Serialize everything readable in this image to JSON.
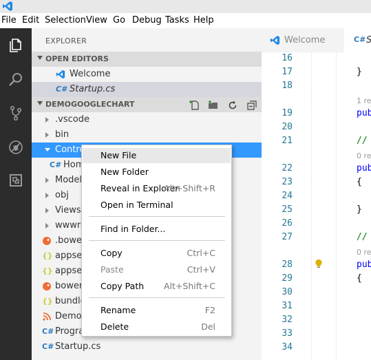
{
  "menubar": [
    "File",
    "Edit",
    "Selection",
    "View",
    "Go",
    "Debug",
    "Tasks",
    "Help"
  ],
  "activity": [
    "explorer-icon",
    "search-icon",
    "source-control-icon",
    "debug-icon",
    "extensions-icon"
  ],
  "explorer": {
    "title": "EXPLORER",
    "open_editors_label": "OPEN EDITORS",
    "open_editors": [
      "Welcome",
      "Startup.cs"
    ],
    "project_label": "DEMOGOOGLECHART",
    "tree": [
      ".vscode",
      "bin",
      "Contro",
      "Hom",
      "Model",
      "obj",
      "Views",
      "wwwro",
      ".bower",
      "appset",
      "appset",
      "bower.",
      "bundle",
      "DemoG",
      "Progra",
      "Startup.cs"
    ]
  },
  "tabs": [
    "Welcome",
    "S"
  ],
  "editor": {
    "line_numbers": [
      "16",
      "17",
      "18",
      "19",
      "20",
      "21",
      "22",
      "23",
      "24",
      "25",
      "26",
      "27",
      "28",
      "29",
      "30",
      "31",
      "32",
      "33",
      "34"
    ],
    "lens": [
      "1 re",
      "0 re",
      "0 re"
    ],
    "code": [
      "}",
      "pub",
      "//",
      "pub",
      "{",
      "}",
      "//",
      "pub",
      "{"
    ]
  },
  "context_menu": {
    "new_file": "New File",
    "new_folder": "New Folder",
    "reveal": "Reveal in Explorer",
    "reveal_key": "Alt+Shift+R",
    "open_terminal": "Open in Terminal",
    "find_in_folder": "Find in Folder...",
    "copy": "Copy",
    "copy_key": "Ctrl+C",
    "paste": "Paste",
    "paste_key": "Ctrl+V",
    "copy_path": "Copy Path",
    "copy_path_key": "Alt+Shift+C",
    "rename": "Rename",
    "rename_key": "F2",
    "delete": "Delete",
    "delete_key": "Del"
  },
  "colors": {
    "accent": "#3399ff",
    "activity_bar": "#2c2c2c",
    "vscode_blue": "#1e88e5",
    "csharp_file": "#2b7bbd",
    "json_file": "#cbcb41",
    "bower_file": "#ef6c34"
  }
}
